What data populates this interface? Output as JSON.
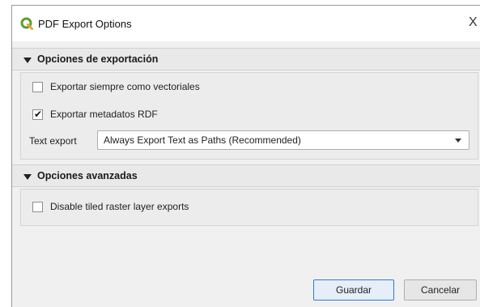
{
  "window": {
    "title": "PDF Export Options",
    "icon": "qgis-logo-icon",
    "close_glyph": "X"
  },
  "sections": {
    "export": {
      "title": "Opciones de exportación",
      "expanded": true,
      "always_vectors": {
        "label": "Exportar siempre como vectoriales",
        "checked": false
      },
      "rdf_metadata": {
        "label": "Exportar metadatos RDF",
        "checked": true
      },
      "text_export": {
        "label": "Text export",
        "value": "Always Export Text as Paths (Recommended)"
      }
    },
    "advanced": {
      "title": "Opciones avanzadas",
      "expanded": true,
      "disable_tiled": {
        "label": "Disable tiled raster layer exports",
        "checked": false
      }
    }
  },
  "buttons": {
    "save": "Guardar",
    "cancel": "Cancelar"
  },
  "colors": {
    "logo_green": "#5a9e2f",
    "primary_border": "#2f7ad6"
  }
}
